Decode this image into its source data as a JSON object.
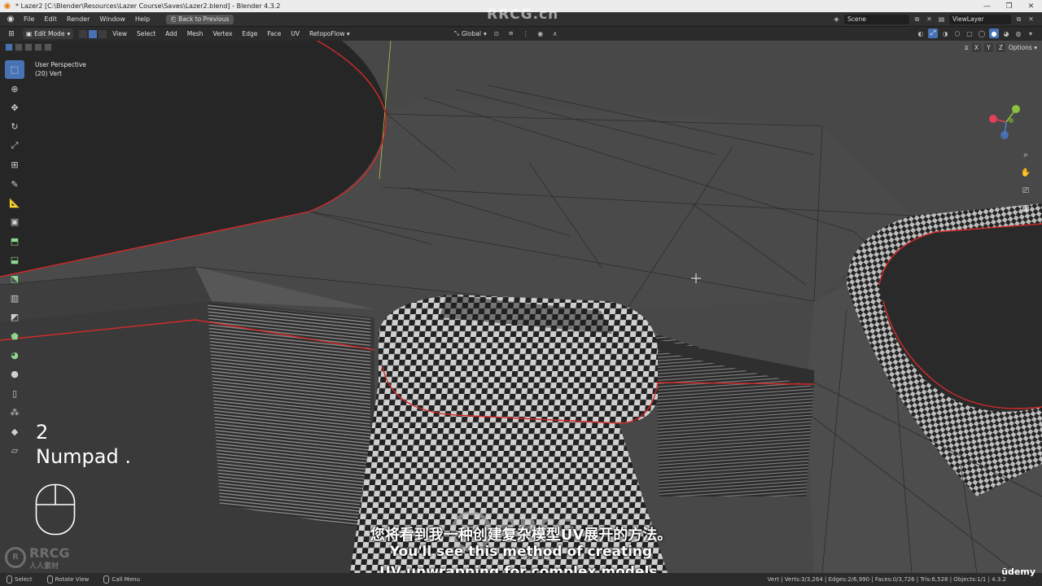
{
  "window": {
    "title": "* Lazer2 [C:\\Blender\\Resources\\Lazer Course\\Saves\\Lazer2.blend] - Blender 4.3.2",
    "controls": [
      "—",
      "❐",
      "✕"
    ]
  },
  "menubar": {
    "items": [
      "File",
      "Edit",
      "Render",
      "Window",
      "Help"
    ],
    "back_button": "Back to Previous",
    "scene": "Scene",
    "view_layer": "ViewLayer"
  },
  "viewport_header": {
    "mode": "Edit Mode",
    "menus": [
      "View",
      "Select",
      "Add",
      "Mesh",
      "Vertex",
      "Edge",
      "Face",
      "UV",
      "RetopoFlow"
    ],
    "transform_orientation": "Global"
  },
  "viewport": {
    "view_name": "User Perspective",
    "selection_info": "(20) Vert",
    "axis_toggles": [
      "X",
      "Y",
      "Z"
    ],
    "options_label": "Options"
  },
  "screencast": {
    "key_line_1": "2",
    "key_line_2": "Numpad ."
  },
  "subtitles": {
    "chinese": "您将看到我一种创建复杂模型UV展开的方法。",
    "english_line_1": "You'll see this method of creating",
    "english_line_2": "UV unwrapping for complex models."
  },
  "watermarks": {
    "top": "RRCG.cn",
    "logo_text": "RRCG",
    "logo_subtext": "人人素材",
    "udemy": "ūdemy"
  },
  "statusbar": {
    "hints": [
      "Select",
      "Rotate View",
      "Call Menu"
    ],
    "stats": "Vert | Verts:3/3,264 | Edges:2/6,990 | Faces:0/3,726 | Tris:6,528 | Objects:1/1 | 4.3.2"
  },
  "colors": {
    "accent": "#4772b3",
    "seam_red": "#d42a2a",
    "app_bg": "#303030",
    "viewport_bg": "#3c3c3c"
  }
}
